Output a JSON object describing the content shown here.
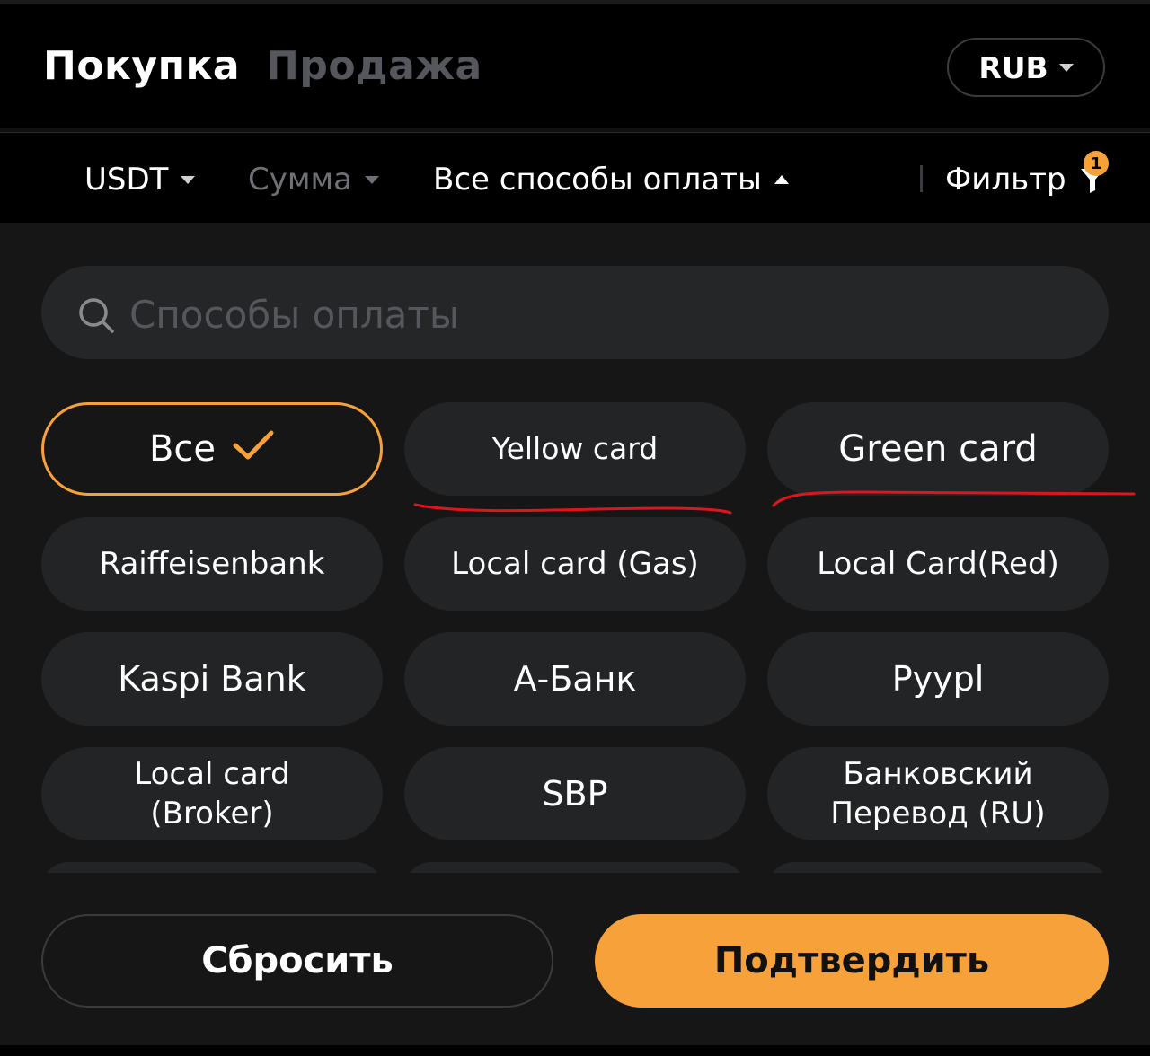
{
  "header": {
    "tab_buy": "Покупка",
    "tab_sell": "Продажа",
    "currency": "RUB"
  },
  "filters": {
    "asset": "USDT",
    "amount": "Сумма",
    "payment_methods": "Все способы оплаты",
    "filter_label": "Фильтр",
    "filter_badge": "1"
  },
  "search": {
    "placeholder": "Способы оплаты"
  },
  "payment_methods": {
    "items": [
      {
        "label": "Все",
        "selected": true
      },
      {
        "label": "Yellow card"
      },
      {
        "label": "Green card"
      },
      {
        "label": "Raiffeisenbank"
      },
      {
        "label": "Local card (Gas)"
      },
      {
        "label": "Local Card(Red)"
      },
      {
        "label": "Kaspi Bank"
      },
      {
        "label": "А-Банк"
      },
      {
        "label": "Руypl"
      },
      {
        "label": "Local card\n(Broker)"
      },
      {
        "label": "SBP"
      },
      {
        "label": "Банковский\nПеревод (RU)"
      }
    ]
  },
  "actions": {
    "reset": "Сбросить",
    "confirm": "Подтвердить"
  },
  "colors": {
    "accent": "#f7a13a",
    "annotation": "#e0141e"
  }
}
